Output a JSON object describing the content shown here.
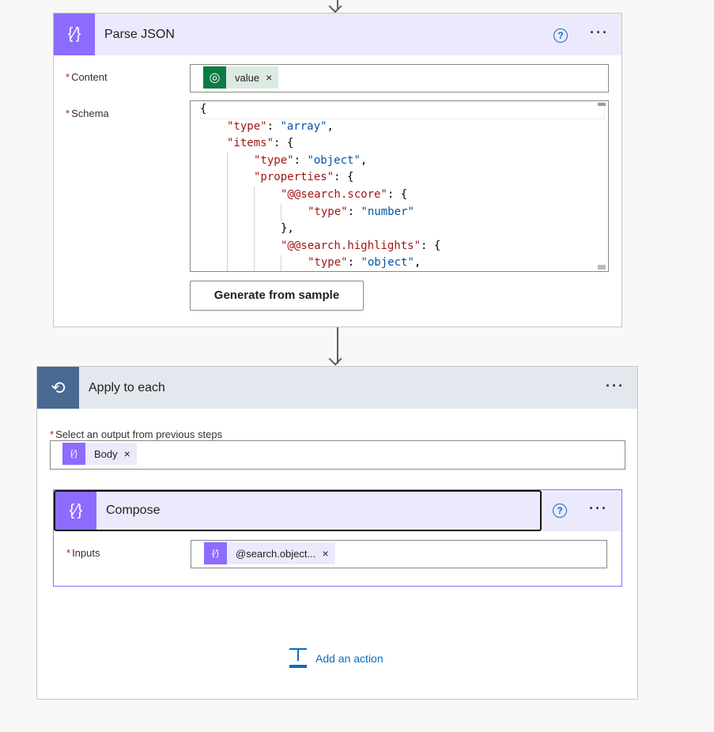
{
  "parse_json": {
    "title": "Parse JSON",
    "content_label": "Content",
    "content_token": "value",
    "schema_label": "Schema",
    "schema_lines": [
      {
        "indent": 0,
        "key": "",
        "val": "",
        "tail": "{"
      },
      {
        "indent": 1,
        "key": "\"type\"",
        "val": "\"array\"",
        "tail": ","
      },
      {
        "indent": 1,
        "key": "\"items\"",
        "val": "",
        "tail": "{"
      },
      {
        "indent": 2,
        "key": "\"type\"",
        "val": "\"object\"",
        "tail": ","
      },
      {
        "indent": 2,
        "key": "\"properties\"",
        "val": "",
        "tail": "{"
      },
      {
        "indent": 3,
        "key": "\"@@search.score\"",
        "val": "",
        "tail": "{"
      },
      {
        "indent": 4,
        "key": "\"type\"",
        "val": "\"number\"",
        "tail": ""
      },
      {
        "indent": 3,
        "key": "",
        "val": "",
        "tail": "},"
      },
      {
        "indent": 3,
        "key": "\"@@search.highlights\"",
        "val": "",
        "tail": "{"
      },
      {
        "indent": 4,
        "key": "\"type\"",
        "val": "\"object\"",
        "tail": ","
      }
    ],
    "generate_button": "Generate from sample",
    "help": "?",
    "more": "···"
  },
  "apply_to_each": {
    "title": "Apply to each",
    "select_label": "Select an output from previous steps",
    "select_token": "Body",
    "more": "···"
  },
  "compose": {
    "title": "Compose",
    "inputs_label": "Inputs",
    "inputs_token": "@search.object...",
    "help": "?",
    "more": "···"
  },
  "add_action": "Add an action",
  "required_mark": "*",
  "remove_mark": "×",
  "colors": {
    "action_purple": "#8c6cff",
    "header_lavender": "#ede9fd",
    "loop_blue": "#486991",
    "loop_header": "#e3e7ee",
    "dataverse_green": "#0b7a43",
    "link_blue": "#0f6cbd"
  }
}
